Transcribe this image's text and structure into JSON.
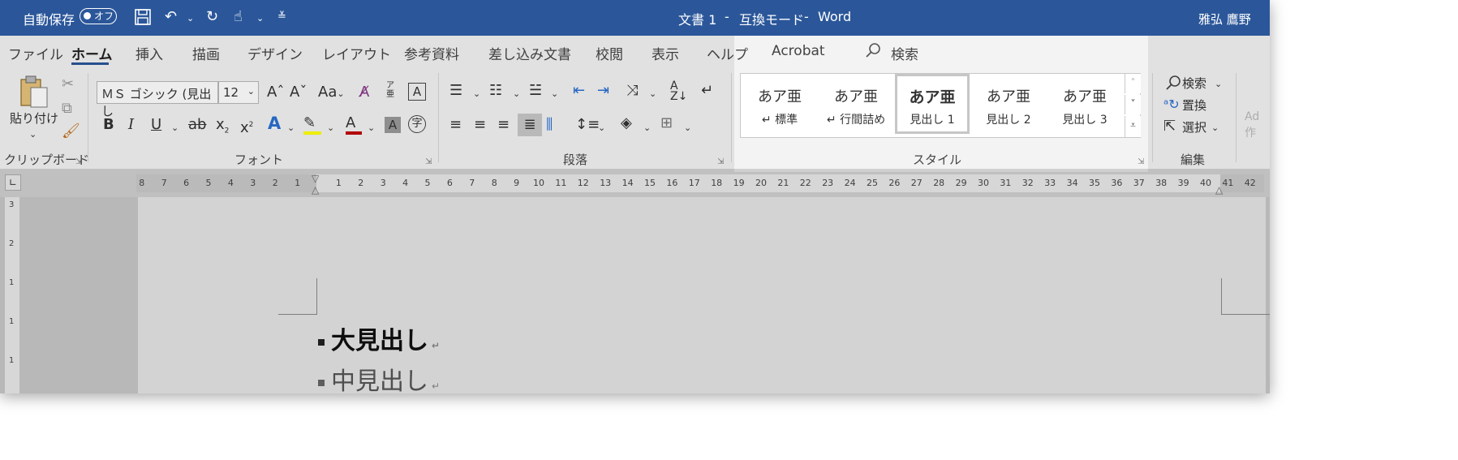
{
  "titlebar": {
    "autosave_label": "自動保存",
    "autosave_state": "オフ",
    "doc_title": "文書 1",
    "mode": "互換モード",
    "app": "Word",
    "sep1": "-",
    "sep2": "-",
    "user": "雅弘 鷹野",
    "background_color": "#2b579a"
  },
  "tabs": [
    {
      "label": "ファイル"
    },
    {
      "label": "ホーム",
      "active": true
    },
    {
      "label": "挿入"
    },
    {
      "label": "描画"
    },
    {
      "label": "デザイン"
    },
    {
      "label": "レイアウト"
    },
    {
      "label": "参考資料"
    },
    {
      "label": "差し込み文書"
    },
    {
      "label": "校閲"
    },
    {
      "label": "表示"
    },
    {
      "label": "ヘルプ"
    },
    {
      "label": "Acrobat"
    }
  ],
  "search": {
    "label": "検索",
    "icon": "search-icon"
  },
  "clipboard": {
    "paste_label": "貼り付け",
    "group_label": "クリップボード"
  },
  "font": {
    "name": "ＭＳ ゴシック (見出し",
    "size": "12",
    "group_label": "フォント",
    "bold": "B",
    "italic": "I",
    "underline": "U",
    "strike": "ab",
    "subscript": "x",
    "superscript": "x",
    "case": "Aa",
    "font_color_letter": "A",
    "highlight_color": "#ffff00",
    "font_color": "#c00000"
  },
  "paragraph": {
    "group_label": "段落"
  },
  "styles": {
    "group_label": "スタイル",
    "items": [
      {
        "preview": "あア亜",
        "name": "↵ 標準"
      },
      {
        "preview": "あア亜",
        "name": "↵ 行間詰め"
      },
      {
        "preview": "あア亜",
        "name": "見出し 1",
        "selected": true
      },
      {
        "preview": "あア亜",
        "name": "見出し 2"
      },
      {
        "preview": "あア亜",
        "name": "見出し 3"
      }
    ]
  },
  "editing": {
    "find": "検索",
    "replace": "置換",
    "select": "選択",
    "group_label": "編集",
    "partial_next": "Ad",
    "partial_next2": "作"
  },
  "ruler": {
    "left_numbers": [
      "8",
      "7",
      "6",
      "5",
      "4",
      "3",
      "2",
      "1"
    ],
    "right_numbers": [
      "1",
      "2",
      "3",
      "4",
      "5",
      "6",
      "7",
      "8",
      "9",
      "10",
      "11",
      "12",
      "13",
      "14",
      "15",
      "16",
      "17",
      "18",
      "19",
      "20",
      "21",
      "22",
      "23",
      "24",
      "25",
      "26",
      "27",
      "28",
      "29",
      "30",
      "31",
      "32",
      "33",
      "34",
      "35",
      "36",
      "37",
      "38",
      "39",
      "40",
      "41",
      "42"
    ],
    "vertical_numbers": [
      "3",
      "2",
      "1",
      "1",
      "1"
    ]
  },
  "document": {
    "heading1": "大見出し",
    "heading2": "中見出し",
    "pilcrow": "↵"
  }
}
